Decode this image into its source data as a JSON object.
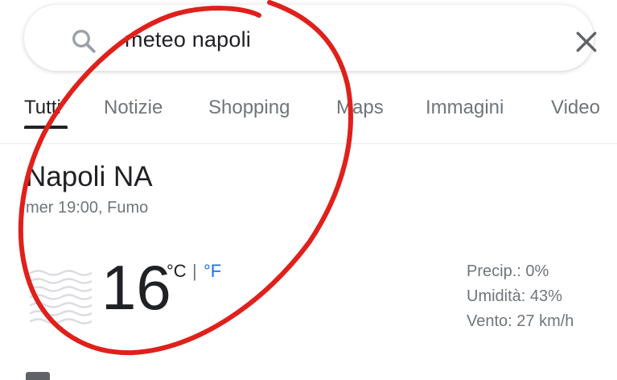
{
  "search": {
    "query": "meteo napoli"
  },
  "tabs": [
    {
      "label": "Tutti",
      "active": true
    },
    {
      "label": "Notizie",
      "active": false
    },
    {
      "label": "Shopping",
      "active": false
    },
    {
      "label": "Maps",
      "active": false
    },
    {
      "label": "Immagini",
      "active": false
    },
    {
      "label": "Video",
      "active": false
    }
  ],
  "weather": {
    "location": "Napoli NA",
    "subtitle": "mer 19:00, Fumo",
    "temperature": "16",
    "unit_celsius": "°C",
    "unit_separator": "|",
    "unit_fahrenheit": "°F",
    "condition_icon": "haze-icon",
    "stats": {
      "precip_label": "Precip.:",
      "precip_value": "0%",
      "humidity_label": "Umidità:",
      "humidity_value": "43%",
      "wind_label": "Vento:",
      "wind_value": "27 km/h"
    }
  },
  "colors": {
    "accent": "#1a73e8",
    "annotation": "#e0201b",
    "text_secondary": "#70757a"
  }
}
